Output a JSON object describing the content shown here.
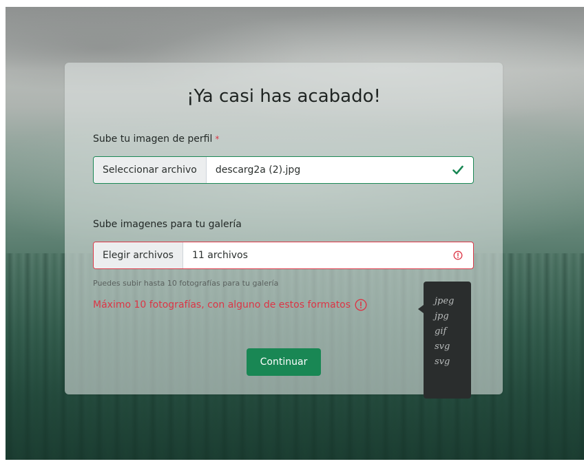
{
  "form": {
    "title": "¡Ya casi has acabado!",
    "profile": {
      "label": "Sube tu imagen de perfil",
      "required_mark": "*",
      "button_label": "Seleccionar archivo",
      "file_value": "descarg2a (2).jpg",
      "state": "valid",
      "state_icon": "check-icon"
    },
    "gallery": {
      "label": "Sube imagenes para tu galería",
      "button_label": "Elegir archivos",
      "file_value": "11 archivos",
      "state": "invalid",
      "state_icon": "exclamation-circle-icon",
      "help_text": "Puedes subir hasta 10 fotografías para tu galería",
      "error_text": "Máximo 10 fotografías, con alguno de estos formatos"
    },
    "submit_label": "Continuar"
  },
  "tooltip": {
    "formats": [
      "jpeg",
      "jpg",
      "gif",
      "svg",
      "svg"
    ]
  },
  "colors": {
    "success": "#198754",
    "danger": "#dc3545",
    "tooltip_bg": "#2a2d2d"
  }
}
